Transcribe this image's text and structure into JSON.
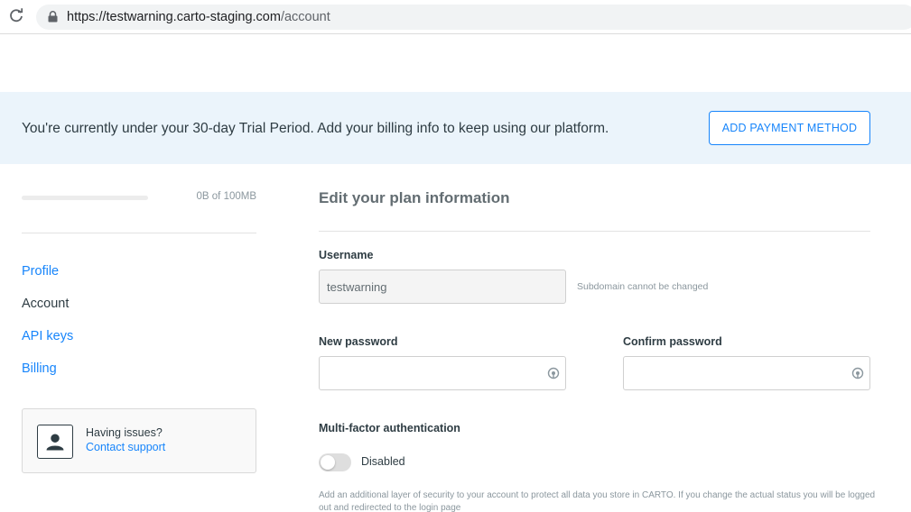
{
  "browser": {
    "url_base": "https://testwarning.carto-staging.com",
    "url_path": "/account"
  },
  "banner": {
    "message": "You're currently under your 30-day Trial Period. Add your billing info to keep using our platform.",
    "button_label": "ADD PAYMENT METHOD"
  },
  "sidebar": {
    "storage": {
      "label": "0B of 100MB",
      "used_fraction": 0
    },
    "nav": [
      {
        "label": "Profile",
        "active": false
      },
      {
        "label": "Account",
        "active": true
      },
      {
        "label": "API keys",
        "active": false
      },
      {
        "label": "Billing",
        "active": false
      }
    ],
    "support": {
      "question": "Having issues?",
      "link": "Contact support"
    }
  },
  "form": {
    "title": "Edit your plan information",
    "username": {
      "label": "Username",
      "value": "testwarning",
      "hint": "Subdomain cannot be changed"
    },
    "new_password": {
      "label": "New password",
      "value": ""
    },
    "confirm_password": {
      "label": "Confirm password",
      "value": ""
    },
    "mfa": {
      "label": "Multi-factor authentication",
      "status": "Disabled",
      "enabled": false,
      "description": "Add an additional layer of security to your account to protect all data you store in CARTO. If you change the actual status you will be logged out and redirected to the login page"
    }
  },
  "colors": {
    "accent": "#1785fb",
    "banner_background": "#ebf4fb",
    "text": "#2e3c43"
  }
}
